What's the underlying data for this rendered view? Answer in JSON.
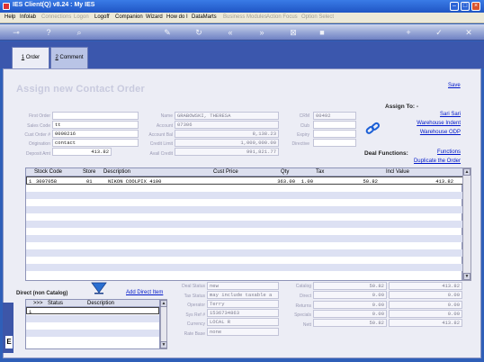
{
  "window": {
    "title": "IES Client(Q) v8.24 : My IES"
  },
  "menu": [
    {
      "label": "Help",
      "enabled": true
    },
    {
      "label": "Infolab",
      "enabled": true
    },
    {
      "label": "Connections",
      "enabled": false
    },
    {
      "label": "Logon",
      "enabled": false
    },
    {
      "label": "Logoff",
      "enabled": true
    },
    {
      "label": "Companion",
      "enabled": true
    },
    {
      "label": "Wizard",
      "enabled": true
    },
    {
      "label": "How do I",
      "enabled": true
    },
    {
      "label": "DataMarts",
      "enabled": true
    },
    {
      "label": "Business Modules",
      "enabled": false
    },
    {
      "label": "Action Focus",
      "enabled": false
    },
    {
      "label": "Option Select",
      "enabled": false
    }
  ],
  "tabs": [
    {
      "num": "1",
      "label": "Order"
    },
    {
      "num": "2",
      "label": "Comment"
    }
  ],
  "form": {
    "title": "Assign new Contact Order",
    "save": "Save",
    "left": {
      "first_order": {
        "label": "First Order",
        "value": ""
      },
      "sales_code": {
        "label": "Sales Code",
        "value": "tt"
      },
      "cust_order": {
        "label": "Cust Order #",
        "value": "0000216"
      },
      "origination": {
        "label": "Origination",
        "value": "contact"
      },
      "deposit_amt": {
        "label": "Deposit Amt",
        "value": "413.82"
      }
    },
    "middle": {
      "name": {
        "label": "Name",
        "value": "GRABOWSKI, THERESA"
      },
      "account": {
        "label": "Account",
        "value": "07306"
      },
      "account_bal": {
        "label": "Account Bal",
        "value": "8,138.23"
      },
      "credit_limit": {
        "label": "Credit Limit",
        "value": "1,000,000.00"
      },
      "avail_credit": {
        "label": "Avail Credit",
        "value": "991,821.77"
      }
    },
    "right": {
      "crm": {
        "label": "CRM",
        "value": "00492"
      },
      "club": {
        "label": "Club",
        "value": ""
      },
      "expiry": {
        "label": "Expiry",
        "value": ""
      },
      "directive": {
        "label": "Directive",
        "value": ""
      }
    },
    "assign_to": {
      "heading": "Assign To: -",
      "links": [
        "Sari Sari",
        "Warehouse Indent",
        "Warehouse ODP"
      ]
    },
    "deal_functions": {
      "heading": "Deal Functions:",
      "links": [
        "Functions",
        "Duplicate the Order"
      ]
    }
  },
  "grid": {
    "headers": [
      "Stock Code",
      "Store",
      "Description",
      "Cust Price",
      "Qty",
      "Tax",
      "Incl Value"
    ],
    "rows": [
      {
        "row": "1",
        "stock_code": "3007058",
        "store": "01",
        "description": "NIKON COOLPIX 4100",
        "cust_price": "363.00",
        "qty": "1.00",
        "tax": "50.82",
        "incl_value": "413.82"
      }
    ]
  },
  "direct": {
    "title": "Direct (non Catalog)",
    "add_link": "Add Direct Item",
    "headers": [
      ">>>",
      "Status",
      "Description"
    ],
    "row_number": "1"
  },
  "deal": {
    "deal_status": {
      "label": "Deal Status",
      "value": "new"
    },
    "tax_status": {
      "label": "Tax Status",
      "value": "may include taxable a"
    },
    "operator": {
      "label": "Operator",
      "value": "Terry"
    },
    "sys_ref": {
      "label": "Sys Ref #",
      "value": "1536734863"
    },
    "currency": {
      "label": "Currency",
      "value": "LOCAL R"
    },
    "rate_base": {
      "label": "Rate Base",
      "value": "none"
    }
  },
  "totals": {
    "catalog": {
      "label": "Catalog",
      "a": "50.82",
      "b": "413.82"
    },
    "direct": {
      "label": "Direct",
      "a": "0.00",
      "b": "0.00"
    },
    "returns": {
      "label": "Returns",
      "a": "0.00",
      "b": "0.00"
    },
    "specials": {
      "label": "Specials",
      "a": "0.00",
      "b": "0.00"
    },
    "nett": {
      "label": "Nett",
      "a": "50.82",
      "b": "413.82"
    }
  },
  "misc": {
    "side_marker": "E"
  },
  "colors": {
    "accent": "#3b57ad",
    "link": "#0018c9",
    "title_watermark": "#c8cade"
  }
}
